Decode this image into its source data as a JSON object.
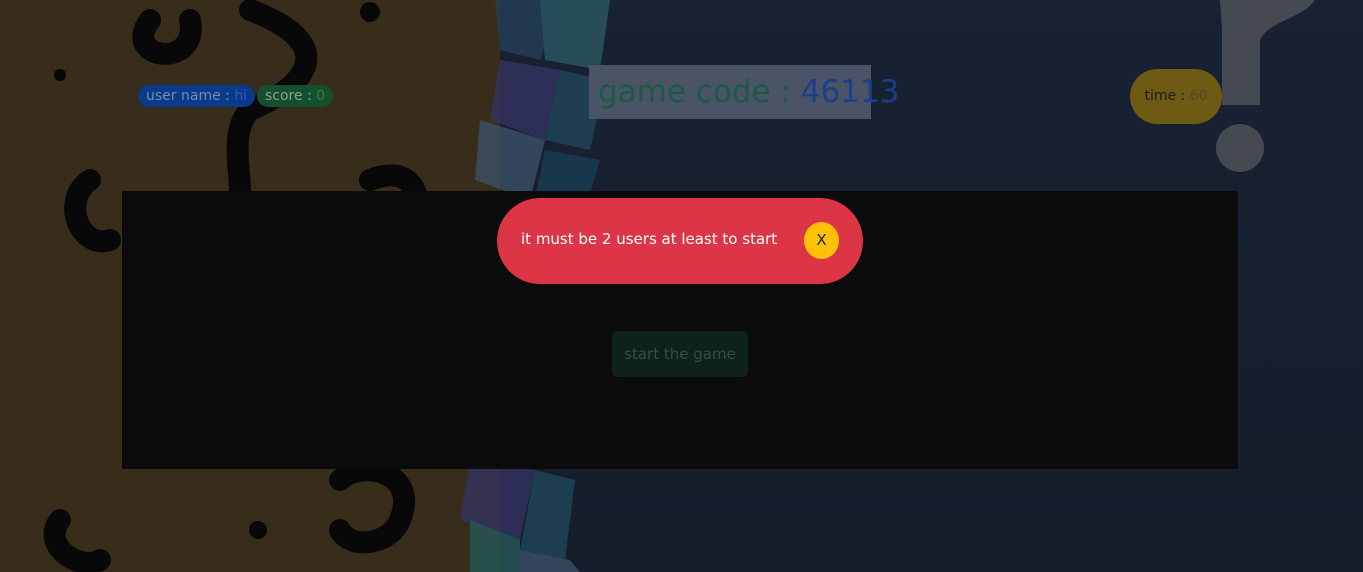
{
  "header": {
    "user_label": "user name : ",
    "user_value": "hi",
    "score_label": "score : ",
    "score_value": "0",
    "game_code_label": "game code : ",
    "game_code_value": "46113",
    "time_label": "time : ",
    "time_value": "60"
  },
  "modal": {
    "start_button_label": "start the game"
  },
  "alert": {
    "message": "it must be 2 users at least to start",
    "close_label": "X"
  },
  "colors": {
    "alert": "#dc3545",
    "close": "#ffc107"
  }
}
